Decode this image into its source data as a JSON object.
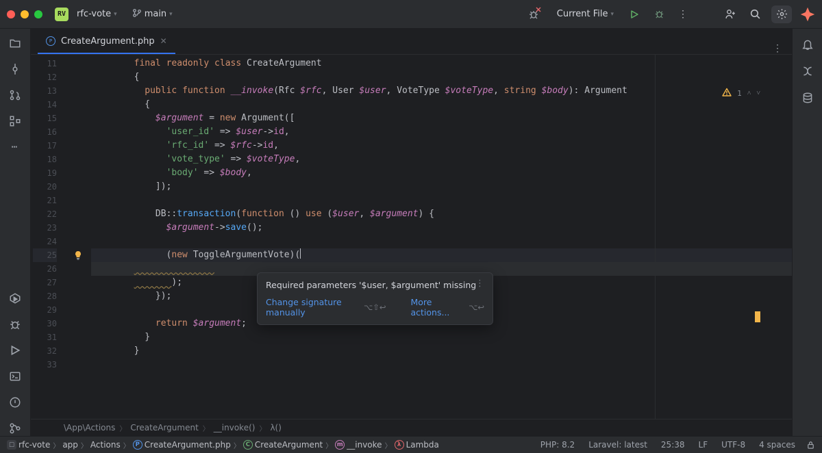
{
  "titlebar": {
    "project_badge": "RV",
    "project_name": "rfc-vote",
    "branch_name": "main",
    "run_config": "Current File"
  },
  "tab": {
    "name": "CreateArgument.php"
  },
  "gutter": {
    "start": 11,
    "end": 33,
    "current": 25,
    "bulb_line": 25
  },
  "code_lines": [
    {
      "n": 11,
      "segs": [
        [
          "ind",
          "        "
        ],
        [
          "kw",
          "final "
        ],
        [
          "kw",
          "readonly "
        ],
        [
          "kw",
          "class "
        ],
        [
          "cl",
          "CreateArgument"
        ]
      ]
    },
    {
      "n": 12,
      "segs": [
        [
          "ind",
          "        "
        ],
        [
          "txt",
          "{"
        ]
      ]
    },
    {
      "n": 13,
      "segs": [
        [
          "ind",
          "          "
        ],
        [
          "kw",
          "public "
        ],
        [
          "kw",
          "function "
        ],
        [
          "mg",
          "__invoke"
        ],
        [
          "txt",
          "("
        ],
        [
          "ty",
          "Rfc "
        ],
        [
          "va",
          "$rfc"
        ],
        [
          "txt",
          ", "
        ],
        [
          "ty",
          "User "
        ],
        [
          "va",
          "$user"
        ],
        [
          "txt",
          ", "
        ],
        [
          "ty",
          "VoteType "
        ],
        [
          "va",
          "$voteType"
        ],
        [
          "txt",
          ", "
        ],
        [
          "kw",
          "string "
        ],
        [
          "va",
          "$body"
        ],
        [
          "txt",
          "): "
        ],
        [
          "ty",
          "Argument"
        ]
      ]
    },
    {
      "n": 14,
      "segs": [
        [
          "ind",
          "          "
        ],
        [
          "txt",
          "{"
        ]
      ]
    },
    {
      "n": 15,
      "segs": [
        [
          "ind",
          "            "
        ],
        [
          "va",
          "$argument"
        ],
        [
          "txt",
          " = "
        ],
        [
          "kw",
          "new "
        ],
        [
          "cl",
          "Argument"
        ],
        [
          "txt",
          "(["
        ]
      ]
    },
    {
      "n": 16,
      "segs": [
        [
          "ind",
          "              "
        ],
        [
          "st",
          "'user_id'"
        ],
        [
          "txt",
          " => "
        ],
        [
          "va",
          "$user"
        ],
        [
          "txt",
          "->"
        ],
        [
          "pr",
          "id"
        ],
        [
          "txt",
          ","
        ]
      ]
    },
    {
      "n": 17,
      "segs": [
        [
          "ind",
          "              "
        ],
        [
          "st",
          "'rfc_id'"
        ],
        [
          "txt",
          " => "
        ],
        [
          "va",
          "$rfc"
        ],
        [
          "txt",
          "->"
        ],
        [
          "pr",
          "id"
        ],
        [
          "txt",
          ","
        ]
      ]
    },
    {
      "n": 18,
      "segs": [
        [
          "ind",
          "              "
        ],
        [
          "st",
          "'vote_type'"
        ],
        [
          "txt",
          " => "
        ],
        [
          "va",
          "$voteType"
        ],
        [
          "txt",
          ","
        ]
      ]
    },
    {
      "n": 19,
      "segs": [
        [
          "ind",
          "              "
        ],
        [
          "st",
          "'body'"
        ],
        [
          "txt",
          " => "
        ],
        [
          "va",
          "$body"
        ],
        [
          "txt",
          ","
        ]
      ]
    },
    {
      "n": 20,
      "segs": [
        [
          "ind",
          "            "
        ],
        [
          "txt",
          "]);"
        ]
      ]
    },
    {
      "n": 21,
      "segs": [
        [
          "txt",
          ""
        ]
      ]
    },
    {
      "n": 22,
      "segs": [
        [
          "ind",
          "            "
        ],
        [
          "cl",
          "DB"
        ],
        [
          "txt",
          "::"
        ],
        [
          "fn",
          "transaction"
        ],
        [
          "txt",
          "("
        ],
        [
          "kw",
          "function "
        ],
        [
          "txt",
          "() "
        ],
        [
          "kw",
          "use "
        ],
        [
          "txt",
          "("
        ],
        [
          "va",
          "$user"
        ],
        [
          "txt",
          ", "
        ],
        [
          "va",
          "$argument"
        ],
        [
          "txt",
          ") {"
        ]
      ]
    },
    {
      "n": 23,
      "segs": [
        [
          "ind",
          "              "
        ],
        [
          "va",
          "$argument"
        ],
        [
          "txt",
          "->"
        ],
        [
          "fn",
          "save"
        ],
        [
          "txt",
          "();"
        ]
      ]
    },
    {
      "n": 24,
      "segs": [
        [
          "txt",
          ""
        ]
      ]
    },
    {
      "n": 25,
      "cur": true,
      "segs": [
        [
          "ind",
          "              "
        ],
        [
          "txt",
          "("
        ],
        [
          "kw",
          "new "
        ],
        [
          "cl",
          "ToggleArgumentVote"
        ],
        [
          "txt",
          ")("
        ],
        [
          "caret",
          ""
        ]
      ]
    },
    {
      "n": 26,
      "band": true,
      "segs": [
        [
          "ind",
          "        "
        ],
        [
          "wave",
          "               "
        ]
      ]
    },
    {
      "n": 27,
      "segs": [
        [
          "ind",
          "        "
        ],
        [
          "wave",
          "       "
        ],
        [
          "txt",
          ");"
        ]
      ]
    },
    {
      "n": 28,
      "segs": [
        [
          "ind",
          "            "
        ],
        [
          "txt",
          "});"
        ]
      ]
    },
    {
      "n": 29,
      "segs": [
        [
          "txt",
          ""
        ]
      ]
    },
    {
      "n": 30,
      "segs": [
        [
          "ind",
          "            "
        ],
        [
          "kw",
          "return "
        ],
        [
          "va",
          "$argument"
        ],
        [
          "txt",
          ";"
        ]
      ]
    },
    {
      "n": 31,
      "segs": [
        [
          "ind",
          "          "
        ],
        [
          "txt",
          "}"
        ]
      ]
    },
    {
      "n": 32,
      "segs": [
        [
          "ind",
          "        "
        ],
        [
          "txt",
          "}"
        ]
      ]
    },
    {
      "n": 33,
      "segs": [
        [
          "txt",
          ""
        ]
      ]
    }
  ],
  "inspection": {
    "warn_count": "1"
  },
  "popup": {
    "message": "Required parameters '$user, $argument' missing",
    "link1": "Change signature manually",
    "short1": "⌥⇧↩",
    "link2": "More actions...",
    "short2": "⌥↩"
  },
  "crumbs": [
    "\\App\\Actions",
    "CreateArgument",
    "__invoke()",
    "λ()"
  ],
  "nav": {
    "path": [
      "rfc-vote",
      "app",
      "Actions",
      "CreateArgument.php",
      "CreateArgument",
      "__invoke",
      "Lambda"
    ],
    "icons": [
      "prj",
      "",
      "",
      "blue",
      "grn",
      "pnk",
      "red"
    ]
  },
  "status": {
    "php": "PHP: 8.2",
    "laravel": "Laravel: latest",
    "pos": "25:38",
    "eol": "LF",
    "enc": "UTF-8",
    "indent": "4 spaces"
  }
}
